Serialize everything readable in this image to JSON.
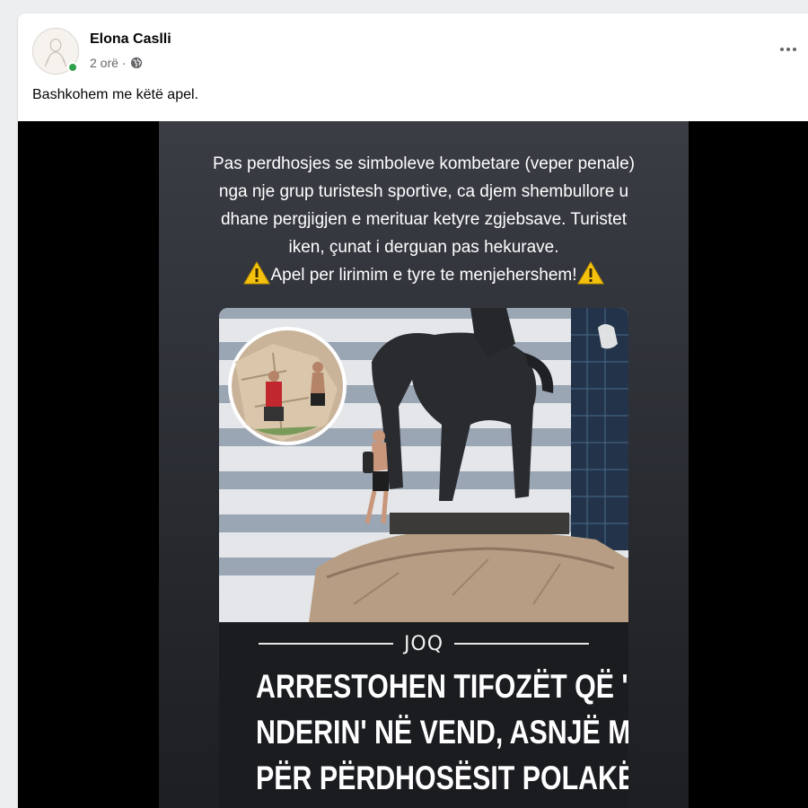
{
  "post": {
    "author": "Elona Caslli",
    "time": "2 orë",
    "separator": "·",
    "text": "Bashkohem me këtë apel.",
    "more_icon": "more-horizontal-icon",
    "privacy_icon": "globe-icon"
  },
  "story": {
    "caption_lines": [
      "Pas perdhosjes se simboleve kombetare (veper penale)",
      "nga nje grup turistesh sportive, ca djem shembullore u",
      "dhane pergjigjen e merituar ketyre zgjebsave. Turistet",
      "iken, çunat i derguan pas hekurave.",
      "Apel per lirimim e tyre te menjehershem!"
    ],
    "warning_icon": "warning-icon",
    "logo_text": "JOQ",
    "headline_lines": [
      "ARRESTOHEN TIFOZËT QË 'VUNË",
      "NDERIN' NË VEND, ASNJË MASË",
      "PËR PËRDHOSËSIT POLAKË"
    ]
  },
  "colors": {
    "online": "#31a24c",
    "warning": "#f4c20d",
    "muted_text": "#65676b"
  }
}
